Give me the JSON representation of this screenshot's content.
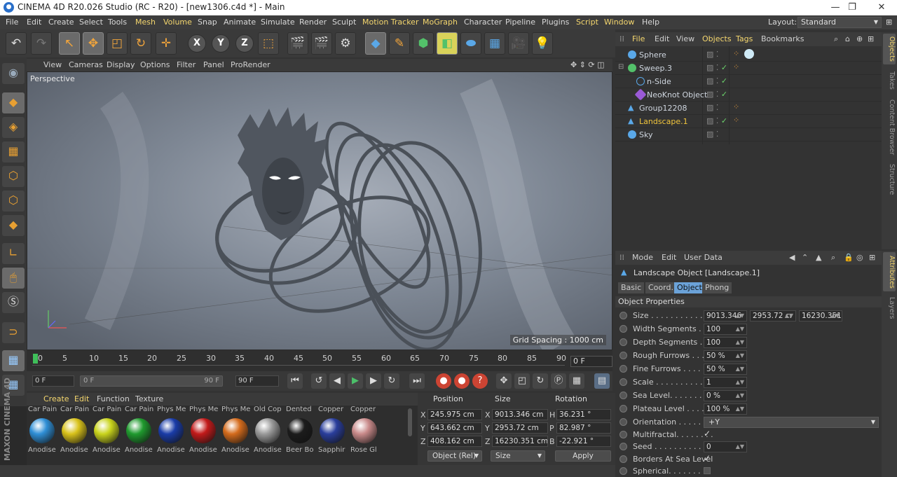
{
  "window": {
    "title": "CINEMA 4D R20.026 Studio (RC - R20) - [new1306.c4d *] - Main"
  },
  "menubar": {
    "items": [
      "File",
      "Edit",
      "Create",
      "Select",
      "Tools",
      "Mesh",
      "Volume",
      "Snap",
      "Animate",
      "Simulate",
      "Render",
      "Sculpt",
      "Motion Tracker",
      "MoGraph",
      "Character",
      "Pipeline",
      "Plugins",
      "Script",
      "Window",
      "Help"
    ],
    "layout_label": "Layout:",
    "layout_value": "Standard"
  },
  "viewport": {
    "menu": [
      "View",
      "Cameras",
      "Display",
      "Options",
      "Filter",
      "Panel",
      "ProRender"
    ],
    "label": "Perspective",
    "grid_spacing": "Grid Spacing : 1000 cm"
  },
  "timeline": {
    "ticks": [
      "0",
      "5",
      "10",
      "15",
      "20",
      "25",
      "30",
      "35",
      "40",
      "45",
      "50",
      "55",
      "60",
      "65",
      "70",
      "75",
      "80",
      "85",
      "90"
    ],
    "current_frame": "0 F"
  },
  "transport": {
    "start_frame": "0 F",
    "slider_start": "0 F",
    "slider_end": "90 F",
    "end_frame": "90 F"
  },
  "materials": {
    "menu": [
      "Create",
      "Edit",
      "Function",
      "Texture"
    ],
    "items": [
      {
        "top": "Car Pain",
        "bottom": "Anodise",
        "color": "#2f8fd6"
      },
      {
        "top": "Car Pain",
        "bottom": "Anodise",
        "color": "#d9c21a"
      },
      {
        "top": "Car Pain",
        "bottom": "Anodise",
        "color": "#c9d41c"
      },
      {
        "top": "Car Pain",
        "bottom": "Anodise",
        "color": "#1f9a2e"
      },
      {
        "top": "Phys Me",
        "bottom": "Anodise",
        "color": "#1a3ca8"
      },
      {
        "top": "Phys Me",
        "bottom": "Anodise",
        "color": "#c21a1a"
      },
      {
        "top": "Phys Me",
        "bottom": "Anodise",
        "color": "#d46b1c"
      },
      {
        "top": "Old Cop",
        "bottom": "Anodise",
        "color": "#9a9a9a"
      },
      {
        "top": "Dented",
        "bottom": "Beer Bo",
        "color": "#1c1c1c"
      },
      {
        "top": "Copper",
        "bottom": "Sapphir",
        "color": "#2a3e9c"
      },
      {
        "top": "Copper",
        "bottom": "Rose Gl",
        "color": "#c98a8a"
      }
    ]
  },
  "coordinates": {
    "headers": [
      "Position",
      "Size",
      "Rotation"
    ],
    "rows": [
      {
        "axis": "X",
        "position": "245.975 cm",
        "size_axis": "X",
        "size": "9013.346 cm",
        "rot_axis": "H",
        "rotation": "36.231 °"
      },
      {
        "axis": "Y",
        "position": "643.662 cm",
        "size_axis": "Y",
        "size": "2953.72 cm",
        "rot_axis": "P",
        "rotation": "82.987 °"
      },
      {
        "axis": "Z",
        "position": "408.162 cm",
        "size_axis": "Z",
        "size": "16230.351 cm",
        "rot_axis": "B",
        "rotation": "-22.921 °"
      }
    ],
    "mode": "Object (Rel)",
    "size_mode": "Size",
    "apply": "Apply"
  },
  "object_manager": {
    "menu": [
      "File",
      "Edit",
      "View",
      "Objects",
      "Tags",
      "Bookmarks"
    ],
    "objects": [
      {
        "name": "Sphere",
        "indent": 0,
        "color": "#5aa8e8",
        "selected": false
      },
      {
        "name": "Sweep.3",
        "indent": 0,
        "color": "#53c16a",
        "selected": false
      },
      {
        "name": "n-Side",
        "indent": 1,
        "color": "#5aa8e8",
        "selected": false
      },
      {
        "name": "NeoKnot Object",
        "indent": 1,
        "color": "#9a5ad6",
        "selected": false
      },
      {
        "name": "Group12208",
        "indent": 0,
        "color": "#5aa8e8",
        "selected": false
      },
      {
        "name": "Landscape.1",
        "indent": 0,
        "color": "#5aa8e8",
        "selected": true
      },
      {
        "name": "Sky",
        "indent": 0,
        "color": "#5aa8e8",
        "selected": false
      }
    ]
  },
  "side_tabs_top": [
    "Objects",
    "Takes",
    "Content Browser",
    "Structure"
  ],
  "side_tabs_bottom": [
    "Attributes",
    "Layers"
  ],
  "attributes": {
    "menu": [
      "Mode",
      "Edit",
      "User Data"
    ],
    "title": "Landscape Object [Landscape.1]",
    "tabs": [
      "Basic",
      "Coord.",
      "Object",
      "Phong"
    ],
    "section": "Object Properties",
    "size": [
      "9013.346",
      "2953.72 cı",
      "16230.351"
    ],
    "rows": [
      {
        "label": "Width Segments . . .",
        "value": "100"
      },
      {
        "label": "Depth Segments . . .",
        "value": "100"
      },
      {
        "label": "Rough Furrows . . . .",
        "value": "50 %"
      },
      {
        "label": "Fine Furrows . . . . .",
        "value": "50 %"
      },
      {
        "label": "Scale . . . . . . . . . . . .",
        "value": "1"
      },
      {
        "label": "Sea Level. . . . . . . .",
        "value": "0 %"
      },
      {
        "label": "Plateau Level . . . . .",
        "value": "100 %"
      }
    ],
    "size_label": "Size . . . . . . . . . . . . .",
    "orientation_label": "Orientation . . . . . . .",
    "orientation_value": "+Y",
    "multifractal_label": "Multifractal. . . . . . . .",
    "seed_label": "Seed . . . . . . . . . . . .",
    "seed_value": "0",
    "borders_label": "Borders At Sea Level",
    "spherical_label": "Spherical. . . . . . . . ."
  }
}
